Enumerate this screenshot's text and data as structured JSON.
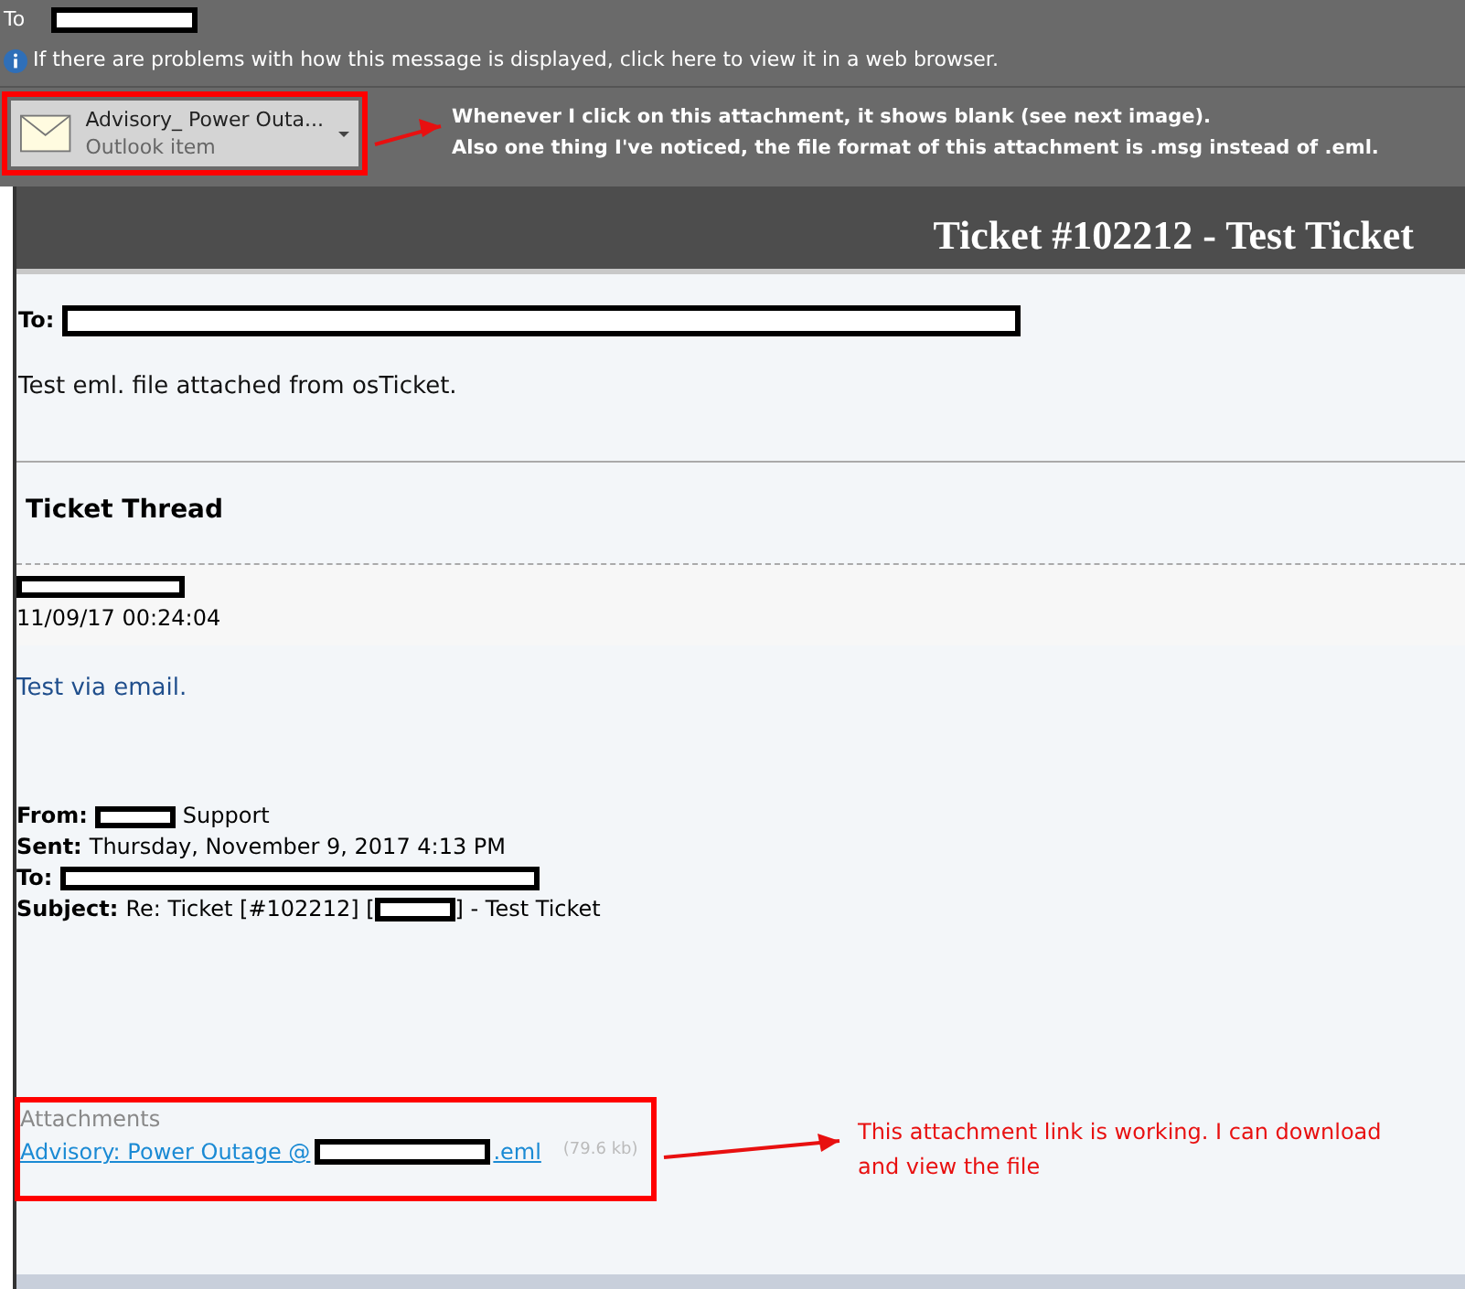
{
  "header": {
    "to_label": "To",
    "info_text": "If there are problems with how this message is displayed, click here to view it in a web browser."
  },
  "attachment": {
    "name": "Advisory_ Power Outa...",
    "type": "Outlook item"
  },
  "note_top": [
    "Whenever I click on this attachment, it shows blank (see next image).",
    "Also one thing I've noticed, the file format of this attachment is .msg instead of .eml."
  ],
  "ticket": {
    "title": "Ticket #102212 - Test Ticket",
    "to_label": "To:",
    "message": "Test eml. file attached from osTicket."
  },
  "thread": {
    "heading": "Ticket Thread",
    "timestamp": "11/09/17 00:24:04",
    "body": "Test via email.",
    "from_label": "From:",
    "from_suffix": "Support",
    "sent_label": "Sent:",
    "sent_value": "Thursday, November 9, 2017 4:13 PM",
    "to_label": "To:",
    "subject_label": "Subject:",
    "subject_before": "Re: Ticket [#102212] [",
    "subject_after": "] - Test Ticket"
  },
  "attachments": {
    "heading": "Attachments",
    "link_before": "Advisory: Power Outage @",
    "link_after": ".eml",
    "size": "(79.6 kb)"
  },
  "note_bottom": "This attachment link is working. I can download and view the file"
}
